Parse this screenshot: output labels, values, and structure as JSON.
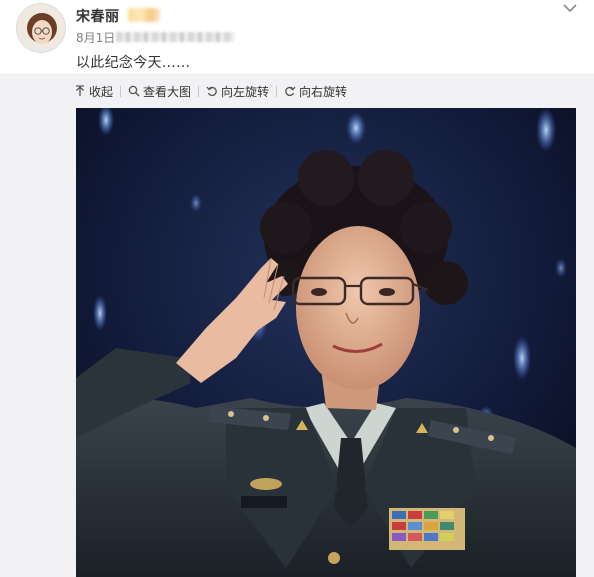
{
  "post": {
    "author": "宋春丽",
    "time": "8月1日",
    "text": "以此纪念今天……"
  },
  "toolbar": {
    "items": [
      {
        "label": "收起",
        "icon": "arrow-up-icon"
      },
      {
        "label": "查看大图",
        "icon": "magnifier-icon"
      },
      {
        "label": "向左旋转",
        "icon": "rotate-left-icon"
      },
      {
        "label": "向右旋转",
        "icon": "rotate-right-icon"
      }
    ]
  },
  "photo": {
    "icon": "photo-saluting-woman"
  },
  "colors": {
    "text": "#333333",
    "muted": "#808080",
    "stage_bg": "#101935",
    "uniform": "#232a31"
  }
}
